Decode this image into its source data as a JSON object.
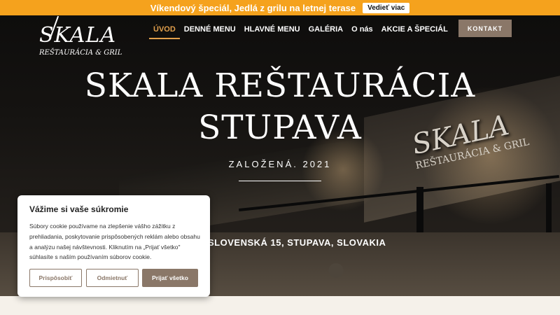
{
  "promo": {
    "text": "Víkendový špeciál, Jedlá z grilu na letnej terase",
    "button": "Vedieť viac"
  },
  "logo": {
    "main": "SKALA",
    "sub": "REŠTAURÁCIA & GRIL"
  },
  "nav": {
    "items": [
      "ÚVOD",
      "DENNÉ MENU",
      "HLAVNÉ MENU",
      "GALÉRIA",
      "O nás",
      "AKCIE A ŠPECIÁL"
    ]
  },
  "contact_button": "KONTAKT",
  "hero": {
    "title_line1": "SKALA REŠTAURÁCIA",
    "title_line2": "STUPAVA",
    "subtitle": "ZALOŽENÁ. 2021",
    "address": "SLOVENSKÁ 15, STUPAVA, SLOVAKIA",
    "sign_main": "SKALA",
    "sign_sub": "REŠTAURÁCIA & GRIL"
  },
  "cookie": {
    "title": "Vážime si vaše súkromie",
    "body": "Súbory cookie používame na zlepšenie vášho zážitku z prehliadania, poskytovanie prispôsobených reklám alebo obsahu a analýzu našej návštevnosti. Kliknutím na „Prijať všetko\" súhlasíte s naším používaním súborov cookie.",
    "customize": "Prispôsobiť",
    "reject": "Odmietnuť",
    "accept": "Prijať všetko"
  },
  "colors": {
    "accent": "#e2a04c",
    "promo": "#f5a21d",
    "brand": "#8a7768"
  }
}
